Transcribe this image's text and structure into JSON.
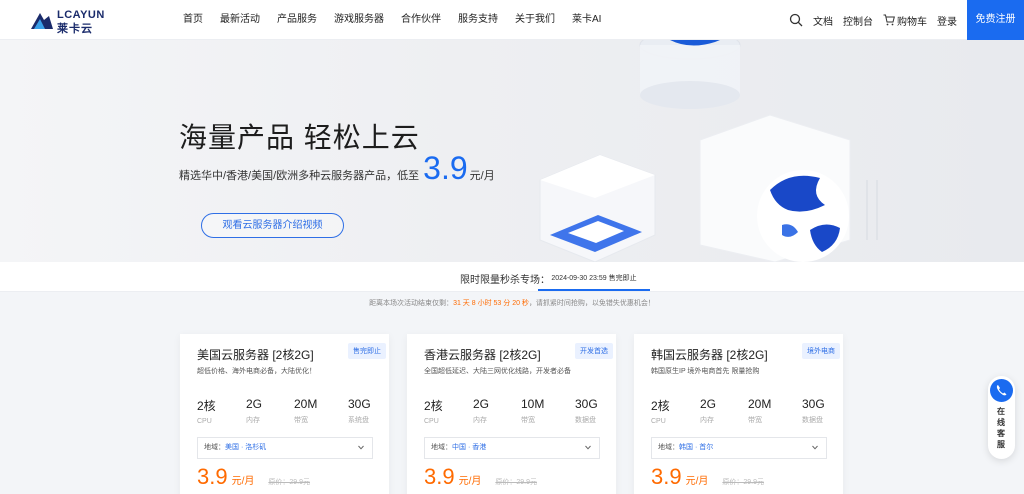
{
  "nav": {
    "logo_en": "LCAYUN",
    "logo_cn": "莱卡云",
    "menu": [
      "首页",
      "最新活动",
      "产品服务",
      "游戏服务器",
      "合作伙伴",
      "服务支持",
      "关于我们",
      "莱卡AI"
    ],
    "docs": "文档",
    "console": "控制台",
    "cart": "购物车",
    "login": "登录",
    "register": "免费注册"
  },
  "hero": {
    "title": "海量产品 轻松上云",
    "subtitle": "精选华中/香港/美国/欧洲多种云服务器产品，低至",
    "price": "3.9",
    "unit": "元/月",
    "video_button": "观看云服务器介绍视频"
  },
  "flash": {
    "label": "限时限量秒杀专场：",
    "tab": "2024-09-30 23:59 售完即止",
    "countdown_prefix": "距离本场次活动结束仅剩：",
    "countdown": "31 天 8 小时 53 分 20 秒",
    "countdown_suffix": "，请抓紧时间抢购，以免错失优惠机会！"
  },
  "cards": [
    {
      "title": "美国云服务器 [2核2G]",
      "badge": "售完即止",
      "desc": "超低价格、海外电商必备，大陆优化！",
      "specs": [
        {
          "value": "2核",
          "label": "CPU"
        },
        {
          "value": "2G",
          "label": "内存"
        },
        {
          "value": "20M",
          "label": "带宽"
        },
        {
          "value": "30G",
          "label": "系统盘"
        }
      ],
      "region_label": "地域：",
      "region": "美国 · 洛杉矶",
      "price": "3.9",
      "unit": "元/月",
      "original": "原价：29.9元"
    },
    {
      "title": "香港云服务器 [2核2G]",
      "badge": "开发首选",
      "desc": "全国超低延迟、大陆三网优化线路，开发者必备",
      "specs": [
        {
          "value": "2核",
          "label": "CPU"
        },
        {
          "value": "2G",
          "label": "内存"
        },
        {
          "value": "10M",
          "label": "带宽"
        },
        {
          "value": "30G",
          "label": "数据盘"
        }
      ],
      "region_label": "地域：",
      "region": "中国 · 香港",
      "price": "3.9",
      "unit": "元/月",
      "original": "原价：29.9元"
    },
    {
      "title": "韩国云服务器 [2核2G]",
      "badge": "境外电商",
      "desc": "韩国原生IP 境外电商首先 限量抢购",
      "specs": [
        {
          "value": "2核",
          "label": "CPU"
        },
        {
          "value": "2G",
          "label": "内存"
        },
        {
          "value": "20M",
          "label": "带宽"
        },
        {
          "value": "30G",
          "label": "数据盘"
        }
      ],
      "region_label": "地域：",
      "region": "韩国 · 首尔",
      "price": "3.9",
      "unit": "元/月",
      "original": "原价：29.9元"
    }
  ],
  "float": {
    "text": "在线客服"
  },
  "colors": {
    "brand_blue": "#1a6bf0",
    "price_orange": "#ff6a00",
    "logo_navy": "#1a2b6b"
  }
}
